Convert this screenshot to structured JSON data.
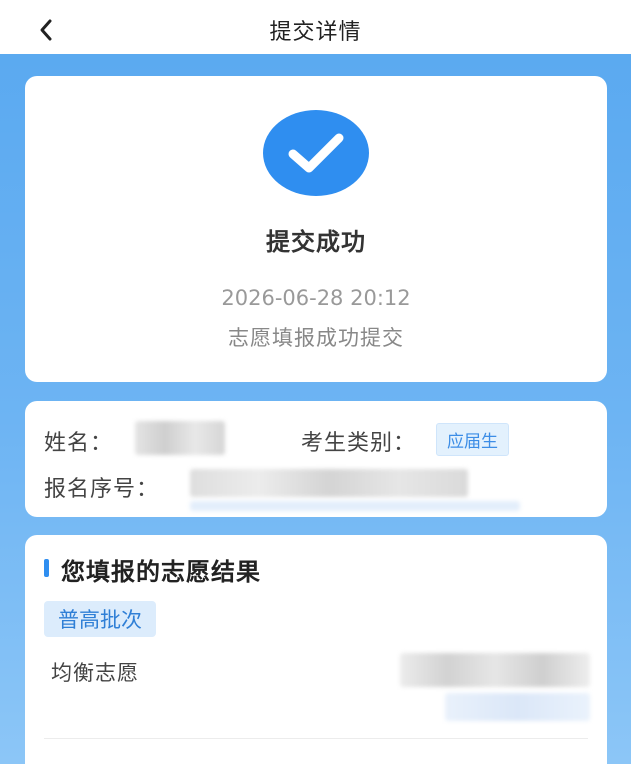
{
  "header": {
    "title": "提交详情",
    "back_icon": "chevron-left-icon"
  },
  "result": {
    "icon": "check-circle-icon",
    "icon_color": "#2f8ef0",
    "title": "提交成功",
    "time": "2026-06-28 20:12",
    "message": "志愿填报成功提交"
  },
  "info": {
    "name_label": "姓名：",
    "category_label": "考生类别：",
    "category_value": "应届生",
    "reg_no_label": "报名序号："
  },
  "wishes": {
    "section_title": "您填报的志愿结果",
    "batch": "普高批次",
    "wish_type": "均衡志愿"
  },
  "colors": {
    "accent": "#2f8ef0",
    "background": "#5aa9f0"
  }
}
